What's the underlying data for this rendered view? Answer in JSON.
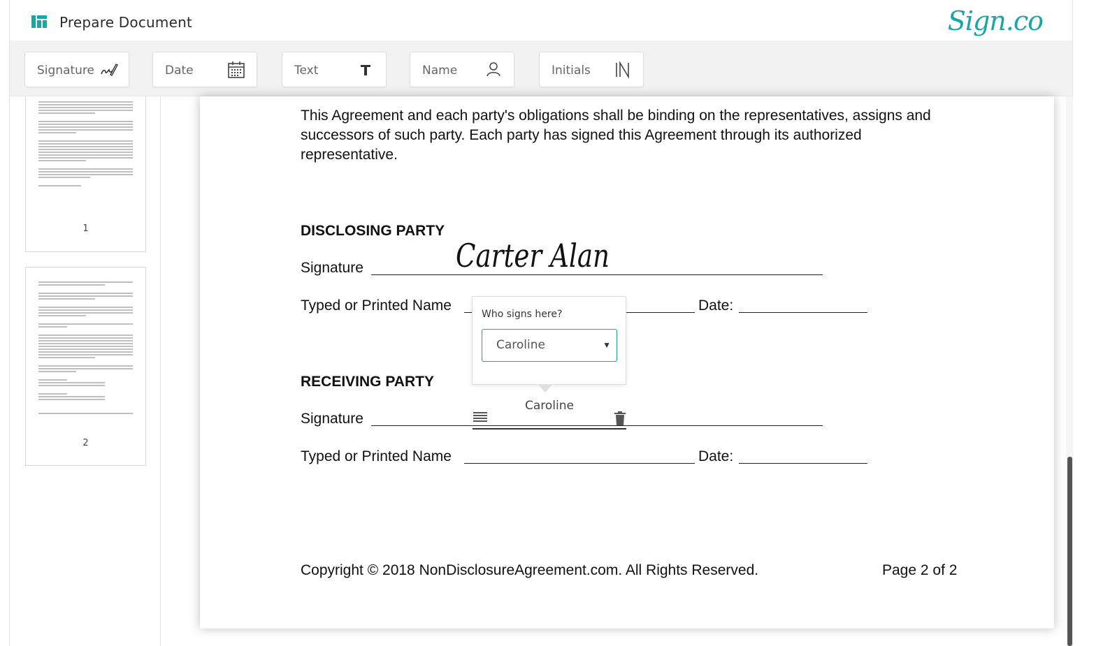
{
  "header": {
    "title": "Prepare Document",
    "brand": "Sign.co",
    "brand_color": "#1aa6a6",
    "app_icon": "layout-icon"
  },
  "toolbar": {
    "tools": [
      {
        "label": "Signature",
        "icon": "signature-pen-icon"
      },
      {
        "label": "Date",
        "icon": "calendar-icon"
      },
      {
        "label": "Text",
        "icon": "text-t-icon"
      },
      {
        "label": "Name",
        "icon": "person-icon"
      },
      {
        "label": "Initials",
        "icon": "initials-in-icon"
      }
    ]
  },
  "sidebar": {
    "pages": [
      {
        "number": "1"
      },
      {
        "number": "2"
      }
    ]
  },
  "document": {
    "paragraph": "This Agreement and each party's obligations shall be binding on the representatives, assigns and successors of such party. Each party has signed this Agreement through its authorized representative.",
    "disclosing_heading": "DISCLOSING PARTY",
    "receiving_heading": "RECEIVING PARTY",
    "signature_label": "Signature",
    "name_label": "Typed or Printed Name",
    "date_label": "Date:",
    "signature_text": "Carter Alan",
    "footer_copyright": "Copyright © 2018 NonDisclosureAgreement.com. All Rights Reserved.",
    "footer_page": "Page 2 of 2"
  },
  "popover": {
    "question": "Who signs here?",
    "selected_signer": "Caroline"
  },
  "placed_field": {
    "assignee": "Caroline",
    "handle_icon": "drag-lines-icon",
    "delete_icon": "trash-icon"
  },
  "scrollbar": {
    "position_fraction": 0.66
  }
}
